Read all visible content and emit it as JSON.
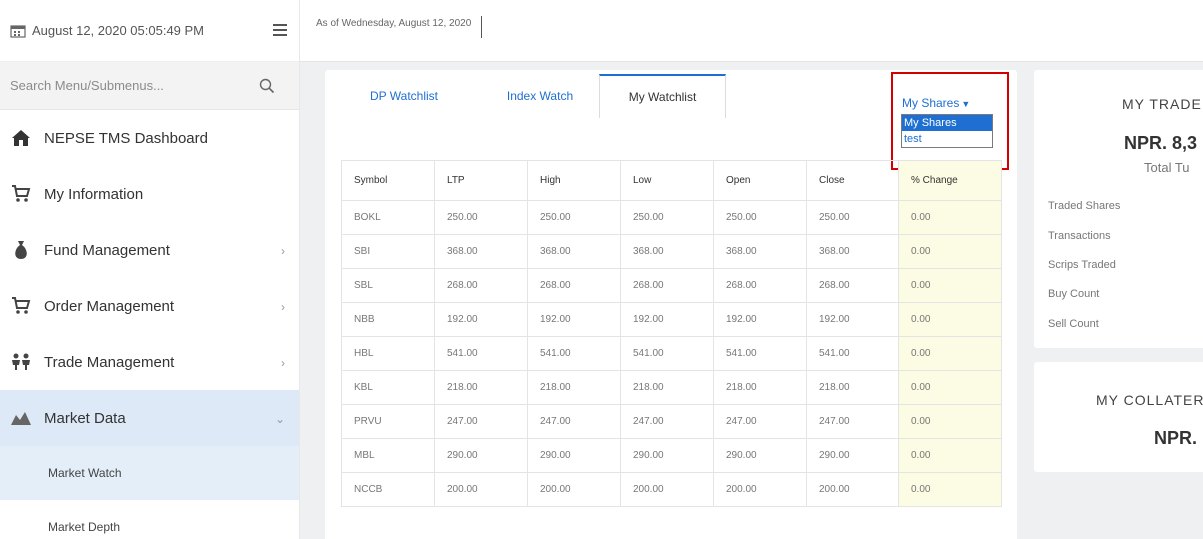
{
  "sidebar": {
    "datetime": "August 12, 2020 05:05:49 PM",
    "search_placeholder": "Search Menu/Submenus...",
    "items": [
      {
        "label": "NEPSE TMS Dashboard",
        "icon": "home-icon"
      },
      {
        "label": "My Information",
        "icon": "cart-icon"
      },
      {
        "label": "Fund Management",
        "icon": "money-bag-icon"
      },
      {
        "label": "Order Management",
        "icon": "cart-icon"
      },
      {
        "label": "Trade Management",
        "icon": "people-icon"
      },
      {
        "label": "Market Data",
        "icon": "chart-icon"
      }
    ],
    "subitems": [
      {
        "label": "Market Watch"
      },
      {
        "label": "Market Depth"
      }
    ]
  },
  "topbar": {
    "as_of": "As of Wednesday, August 12, 2020"
  },
  "watch": {
    "tabs": [
      "DP Watchlist",
      "Index Watch",
      "My Watchlist"
    ],
    "dropdown": {
      "current": "My Shares",
      "options": [
        "My Shares",
        "test"
      ]
    },
    "columns": [
      "Symbol",
      "LTP",
      "High",
      "Low",
      "Open",
      "Close",
      "% Change"
    ],
    "rows": [
      [
        "BOKL",
        "250.00",
        "250.00",
        "250.00",
        "250.00",
        "250.00",
        "0.00"
      ],
      [
        "SBI",
        "368.00",
        "368.00",
        "368.00",
        "368.00",
        "368.00",
        "0.00"
      ],
      [
        "SBL",
        "268.00",
        "268.00",
        "268.00",
        "268.00",
        "268.00",
        "0.00"
      ],
      [
        "NBB",
        "192.00",
        "192.00",
        "192.00",
        "192.00",
        "192.00",
        "0.00"
      ],
      [
        "HBL",
        "541.00",
        "541.00",
        "541.00",
        "541.00",
        "541.00",
        "0.00"
      ],
      [
        "KBL",
        "218.00",
        "218.00",
        "218.00",
        "218.00",
        "218.00",
        "0.00"
      ],
      [
        "PRVU",
        "247.00",
        "247.00",
        "247.00",
        "247.00",
        "247.00",
        "0.00"
      ],
      [
        "MBL",
        "290.00",
        "290.00",
        "290.00",
        "290.00",
        "290.00",
        "0.00"
      ],
      [
        "NCCB",
        "200.00",
        "200.00",
        "200.00",
        "200.00",
        "200.00",
        "0.00"
      ]
    ]
  },
  "trade": {
    "title": "MY TRADE",
    "amount": "NPR. 8,3",
    "subtitle": "Total Tu",
    "stats": [
      "Traded Shares",
      "Transactions",
      "Scrips Traded",
      "Buy Count",
      "Sell Count"
    ]
  },
  "collateral": {
    "title": "MY COLLATER",
    "amount": "NPR. "
  },
  "colors": {
    "accent": "#1e6fd1",
    "highlight_box": "#d40000",
    "active_nav": "#dde9f6",
    "change_col": "#fcfbe3"
  }
}
